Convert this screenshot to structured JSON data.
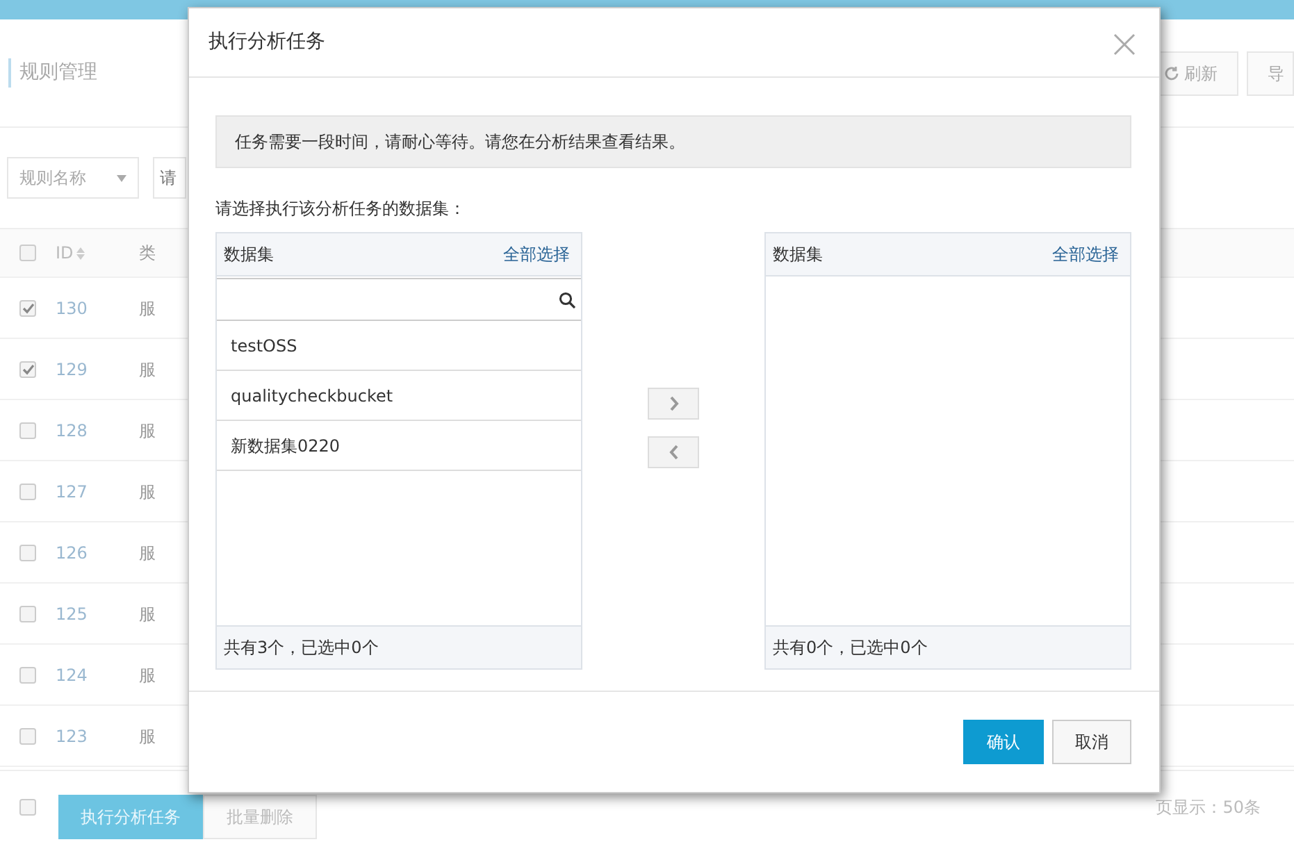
{
  "page": {
    "title": "规则管理",
    "toolbar_buttons": [
      "刷新",
      "导"
    ],
    "filter": {
      "select": "规则名称",
      "placeholder": "请"
    },
    "table": {
      "columns": [
        "ID",
        "类"
      ],
      "header_checked": false,
      "rows": [
        {
          "id": "130",
          "column_2": "服",
          "checked": true
        },
        {
          "id": "129",
          "column_2": "服",
          "checked": true
        },
        {
          "id": "128",
          "column_2": "服",
          "checked": false
        },
        {
          "id": "127",
          "column_2": "服",
          "checked": false
        },
        {
          "id": "126",
          "column_2": "服",
          "checked": false
        },
        {
          "id": "125",
          "column_2": "服",
          "checked": false
        },
        {
          "id": "124",
          "column_2": "服",
          "checked": false
        },
        {
          "id": "123",
          "column_2": "服",
          "checked": false
        }
      ]
    },
    "footer": {
      "checked": false,
      "buttons": [
        "执行分析任务",
        "批量删除"
      ],
      "page_size": "页显示：50条"
    }
  },
  "modal": {
    "title": "执行分析任务",
    "notice": "任务需要一段时间，请耐心等待。请您在分析结果查看结果。",
    "prompt": "请选择执行该分析任务的数据集：",
    "panels": [
      {
        "title": "数据集",
        "select_all": "全部选择",
        "search": true,
        "items": [
          "testOSS",
          "qualitycheckbucket",
          "新数据集0220"
        ],
        "summary": "共有3个，已选中0个"
      },
      {
        "title": "数据集",
        "select_all": "全部选择",
        "search": false,
        "summary": "共有0个，已选中0个"
      }
    ],
    "buttons": [
      "确认",
      "取消"
    ]
  }
}
